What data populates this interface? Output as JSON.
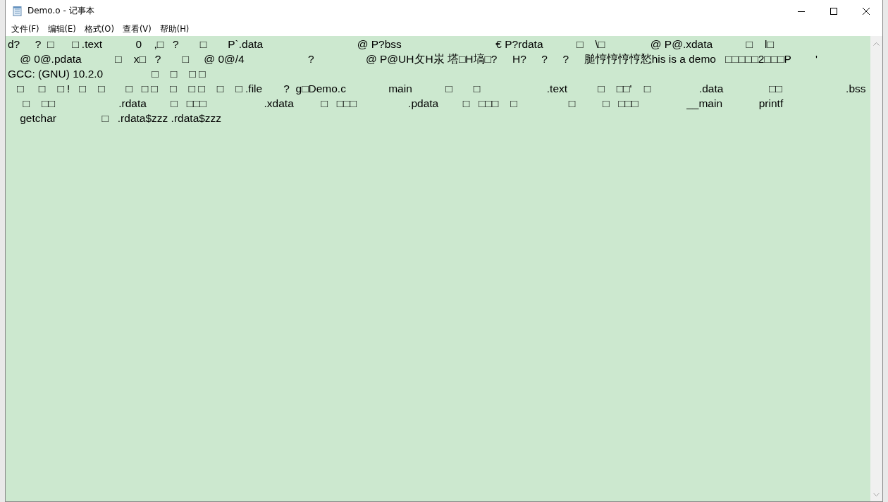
{
  "window": {
    "title": "Demo.o - 记事本"
  },
  "menu": [
    "文件(F)",
    "编辑(E)",
    "格式(O)",
    "查看(V)",
    "帮助(H)"
  ],
  "editor": {
    "lines": [
      "d?     ?  □      □ .text           0    ,□   ?       □       P`.data                               @ P?bss                               € P?rdata           □    \\□               @ P@.xdata           □    l□",
      "    @ 0@.pdata           □    x□   ?       □     @ 0@/4                     ?                 @ P@UH攵H汖 塔□H塙□?     H?     ?     ?     膇悙悙悙悙悐his is a demo   □□□□□2□□□P        '",
      "GCC: (GNU) 10.2.0                □    □    □ □",
      "   □     □    □ !   □    □       □   □ □    □    □ □    □    □ .file       ?  g□Demo.c              main           □       □                      .text          □    □□'    □                .data               □□                     .bss",
      "     □    □□                     .rdata        □   □□□                   .xdata         □   □□□                 .pdata        □   □□□    □                 □         □   □□□                __main            printf",
      "    getchar               □   .rdata$zzz .rdata$zzz"
    ]
  }
}
